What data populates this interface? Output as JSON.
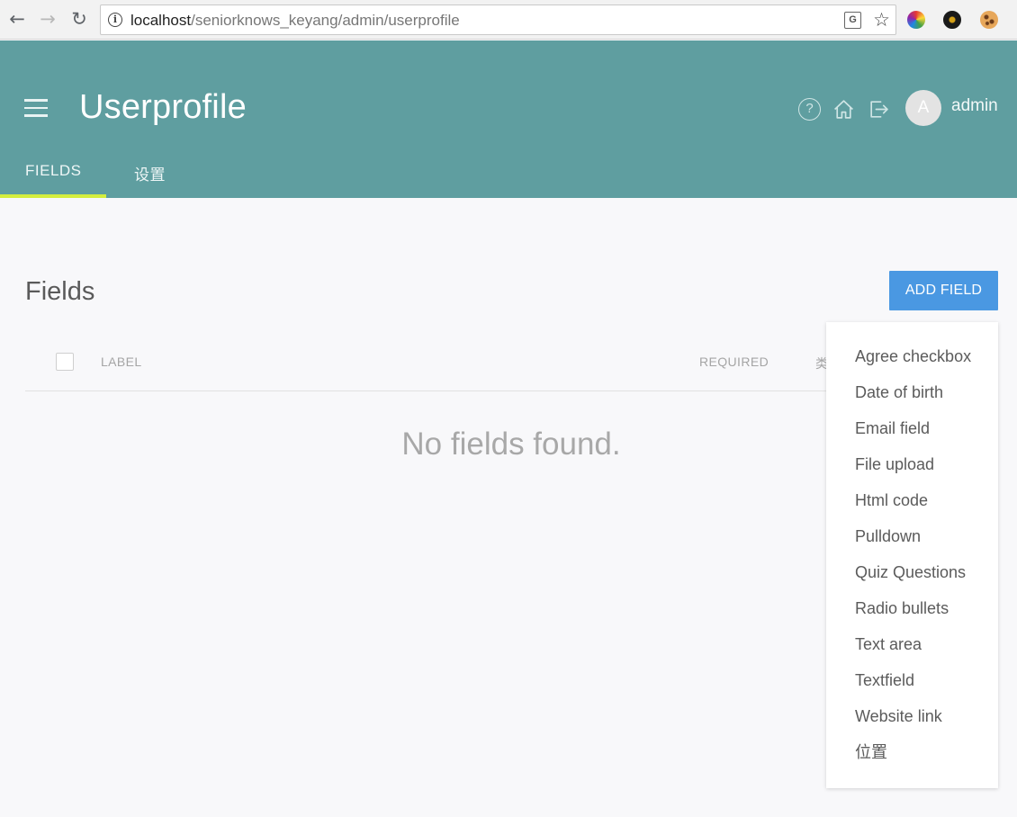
{
  "browser": {
    "url_host": "localhost",
    "url_path": "/seniorknows_keyang/admin/userprofile",
    "translate_icon_text": "G",
    "back_glyph": "←",
    "forward_glyph": "→",
    "reload_glyph": "↻",
    "star_glyph": "☆"
  },
  "header": {
    "title": "Userprofile",
    "help_glyph": "?",
    "avatar_letter": "A",
    "username": "admin",
    "tabs": [
      {
        "label": "FIELDS",
        "active": true
      },
      {
        "label": "设置",
        "active": false
      }
    ],
    "accent_color": "#d4ee3e",
    "bar_color": "#5f9ea0"
  },
  "main": {
    "section_title": "Fields",
    "add_button_label": "ADD FIELD",
    "add_button_color": "#4a98e2",
    "columns": [
      "LABEL",
      "REQUIRED",
      "类"
    ],
    "empty_message": "No fields found."
  },
  "dropdown": {
    "items": [
      "Agree checkbox",
      "Date of birth",
      "Email field",
      "File upload",
      "Html code",
      "Pulldown",
      "Quiz Questions",
      "Radio bullets",
      "Text area",
      "Textfield",
      "Website link",
      "位置"
    ]
  }
}
